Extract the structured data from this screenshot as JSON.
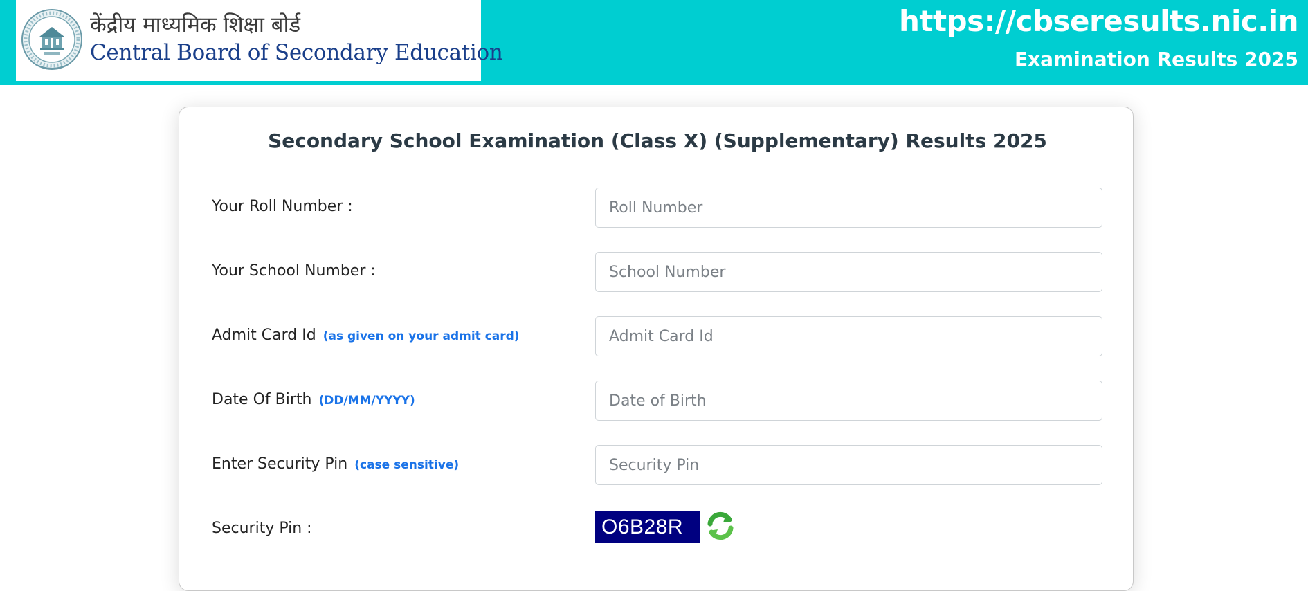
{
  "header": {
    "hindi_name": "केंद्रीय माध्यमिक शिक्षा बोर्ड",
    "english_name": "Central Board of Secondary Education",
    "site_url": "https://cbseresults.nic.in",
    "site_subtitle": "Examination Results 2025",
    "bg_color": "#00ced1"
  },
  "form": {
    "title": "Secondary School Examination (Class X) (Supplementary) Results 2025",
    "fields": [
      {
        "label": "Your Roll Number :",
        "hint": "",
        "placeholder": "Roll Number",
        "value": ""
      },
      {
        "label": "Your School Number :",
        "hint": "",
        "placeholder": "School Number",
        "value": ""
      },
      {
        "label": "Admit Card Id",
        "hint": "(as given on your admit card)",
        "placeholder": "Admit Card Id",
        "value": ""
      },
      {
        "label": "Date Of Birth",
        "hint": "(DD/MM/YYYY)",
        "placeholder": "Date of Birth",
        "value": ""
      },
      {
        "label": "Enter Security Pin",
        "hint": "(case sensitive)",
        "placeholder": "Security Pin",
        "value": ""
      }
    ],
    "security_pin_label": "Security Pin :",
    "captcha_text": "O6B28R",
    "refresh_icon": "refresh-icon",
    "hint_color": "#1a73e8",
    "captcha_bg": "#000080"
  }
}
